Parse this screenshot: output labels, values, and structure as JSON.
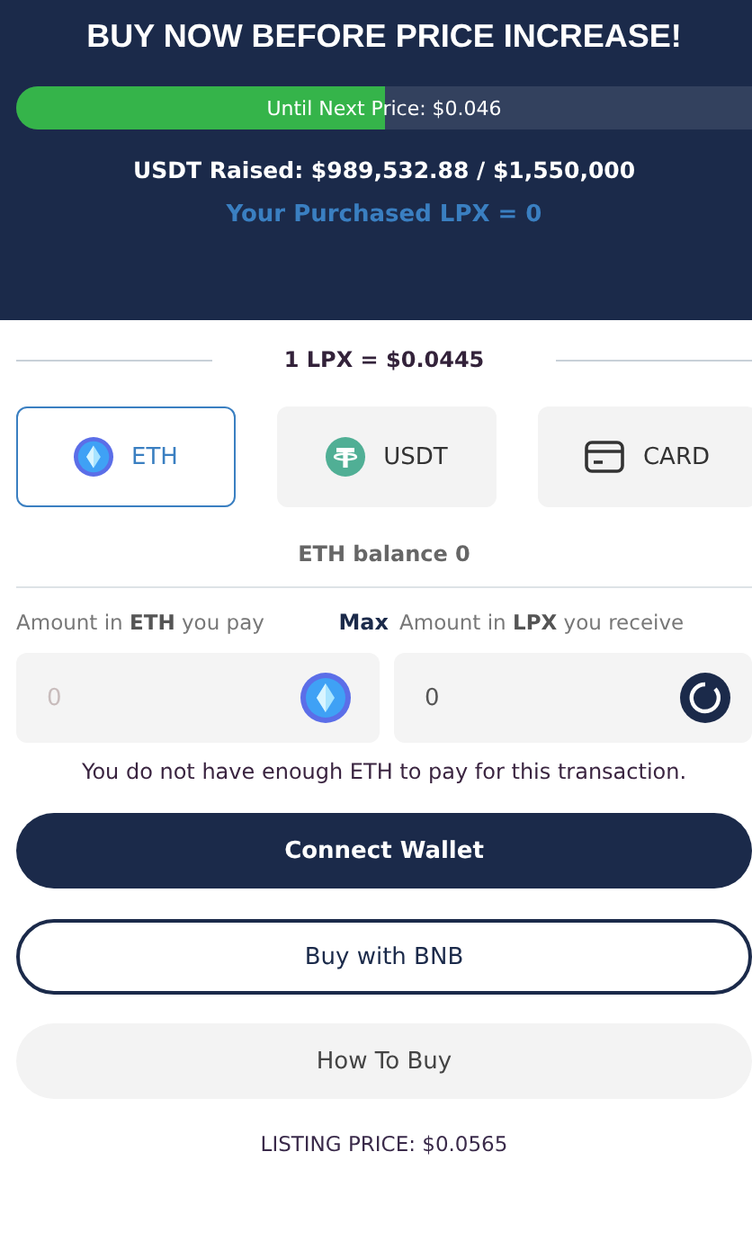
{
  "header": {
    "title": "BUY NOW BEFORE PRICE INCREASE!",
    "progress": {
      "label": "Until Next Price: $0.046",
      "level": 0.5
    },
    "raised": "USDT Raised: $989,532.88 / $1,550,000",
    "purchased": "Your Purchased LPX = 0"
  },
  "rate": "1 LPX = $0.0445",
  "payment_tabs": [
    {
      "label": "ETH",
      "kind": "eth",
      "selected": true
    },
    {
      "label": "USDT",
      "kind": "usdt",
      "selected": false
    },
    {
      "label": "CARD",
      "kind": "card",
      "selected": false
    }
  ],
  "balance": "ETH balance 0",
  "pay_label": "Amount in **ETH** you pay",
  "max": "Max",
  "receive_label": "Amount in **LPX** you receive",
  "pay_field": {
    "placeholder": "0"
  },
  "receive_field": {
    "value": "0"
  },
  "error": "You do not have enough ETH to pay for this transaction.",
  "buttons": [
    {
      "label": "Connect Wallet",
      "kind": "primary"
    },
    {
      "label": "Buy with BNB",
      "kind": "outline"
    },
    {
      "label": "How To Buy",
      "kind": "light"
    }
  ],
  "listing_price": "LISTING PRICE: $0.0565"
}
